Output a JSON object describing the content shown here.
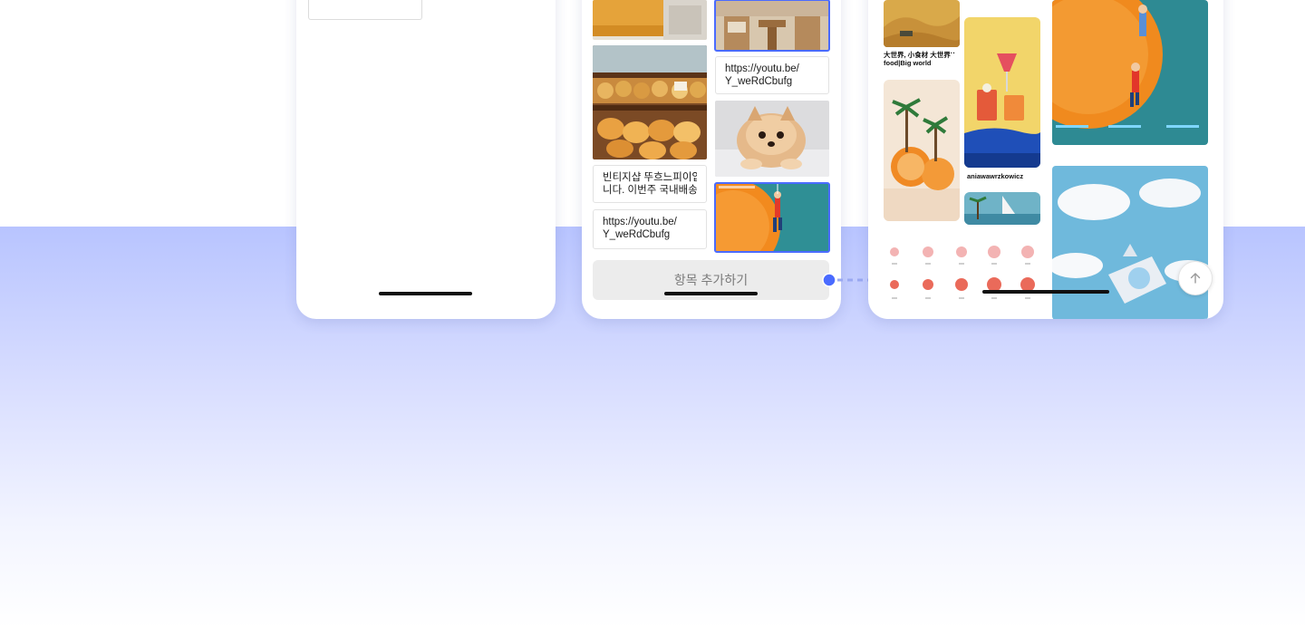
{
  "phone_middle": {
    "text_cards": [
      {
        "line1": "https://youtu.be/",
        "line2": "Y_weRdCbufg"
      },
      {
        "line1": "빈티지샵 뚜흐느피이입",
        "line2": "니다. 이번주 국내배송..."
      },
      {
        "line1": "https://youtu.be/",
        "line2": "Y_weRdCbufg"
      }
    ],
    "add_button_label": "항목 추가하기"
  },
  "phone_right": {
    "captions": {
      "big_world": {
        "line1": "大世界, 小食材 大世界",
        "line2": "food|Big world"
      },
      "username": "aniawawrzkowicz"
    },
    "more_glyph": "···"
  },
  "icons": {
    "scroll_top": "arrow-up-icon",
    "connector": "dot-connector-icon"
  },
  "colors": {
    "accent": "#4a6bff",
    "band_top": "#b8c4ff",
    "button_bg": "#ececec",
    "button_text": "#7a7a7a"
  }
}
